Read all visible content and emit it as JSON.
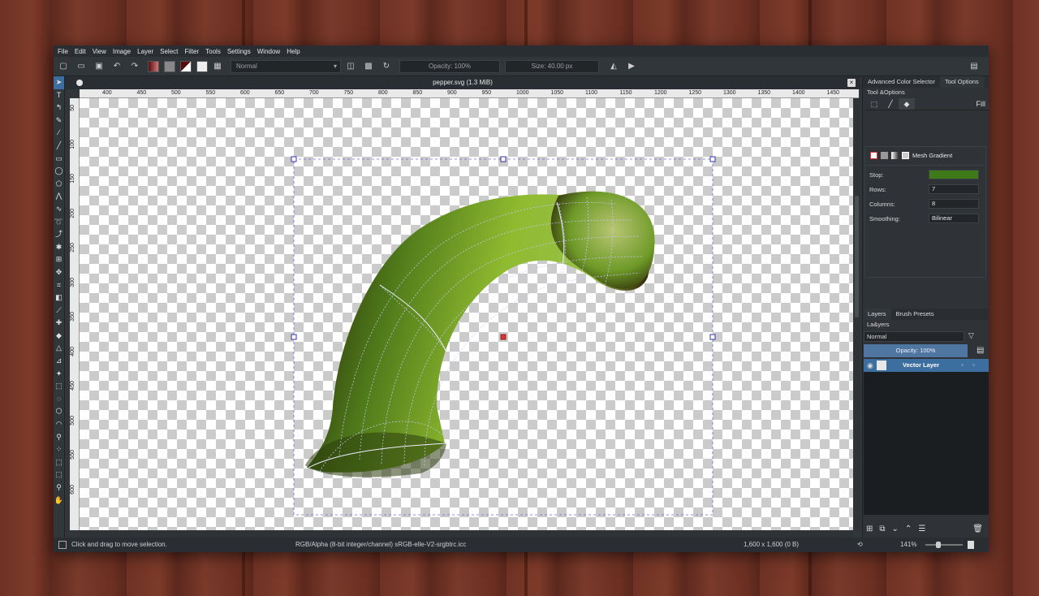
{
  "window": {
    "title": "pepper.svg (1.3 MiB)"
  },
  "menu": [
    "File",
    "Edit",
    "View",
    "Image",
    "Layer",
    "Select",
    "Filter",
    "Tools",
    "Settings",
    "Window",
    "Help"
  ],
  "toolbar": {
    "blend_mode": "Normal",
    "opacity": "Opacity: 100%",
    "size": "Size: 40.00 px"
  },
  "ruler": {
    "h": [
      "400",
      "450",
      "500",
      "550",
      "600",
      "650",
      "700",
      "750",
      "800",
      "850",
      "900",
      "950",
      "1000",
      "1050",
      "1100",
      "1150",
      "1200",
      "1250",
      "1300",
      "1350",
      "1400",
      "1450"
    ],
    "v": [
      "50",
      "100",
      "150",
      "200",
      "250",
      "300",
      "350",
      "400",
      "450",
      "500",
      "550",
      "600"
    ]
  },
  "status": {
    "hint": "Click and drag to move selection.",
    "color_info": "RGB/Alpha (8-bit integer/channel)  sRGB-elle-V2-srgbtrc.icc",
    "dimensions": "1,600 x 1,600 (0 B)",
    "zoom": "141%"
  },
  "dock": {
    "top_tabs": [
      "Advanced Color Selector",
      "Tool Options"
    ],
    "tool_options_title": "Tool &Options",
    "fill_label": "Fill",
    "gradient_type": "Mesh Gradient",
    "stop_label": "Stop:",
    "stop_color": "#3f7a1a",
    "rows_label": "Rows:",
    "rows_value": "7",
    "columns_label": "Columns:",
    "columns_value": "8",
    "smoothing_label": "Smoothing:",
    "smoothing_value": "Bilinear",
    "layer_tabs": [
      "Layers",
      "Brush Presets"
    ],
    "layers_title": "La&yers",
    "layer_blend": "Normal",
    "layer_opacity": "Opacity: 100%",
    "layer_name": "Vector Layer"
  },
  "colors": {
    "accent": "#3d6ea0",
    "panel": "#31363b",
    "wood": "#6e3224",
    "pepper": "#6e9e2a"
  }
}
